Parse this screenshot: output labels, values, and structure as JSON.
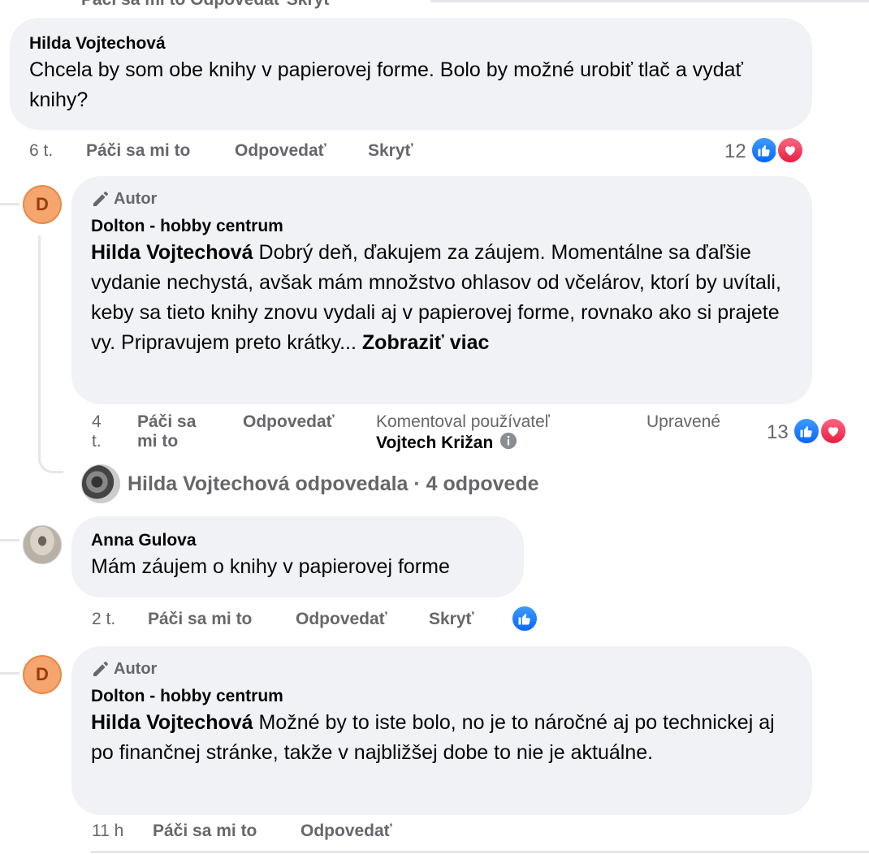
{
  "top_fragment": "Páči sa mi to   Odpovedať   Skryť",
  "comment1": {
    "author": "Hilda Vojtechová",
    "text": "Chcela by som obe knihy v papierovej forme. Bolo by možné urobiť tlač a vydať knihy?",
    "time": "6 t.",
    "like_label": "Páči sa mi to",
    "reply_label": "Odpovedať",
    "hide_label": "Skryť",
    "reaction_count": "12"
  },
  "reply1": {
    "badge": "Autor",
    "author": "Dolton - hobby centrum",
    "mention": "Hilda Vojtechová",
    "text": "Dobrý deň, ďakujem za záujem. Momentálne sa ďaľšie vydanie nechystá, avšak mám množstvo ohlasov od včelárov, ktorí by uvítali, keby sa tieto knihy znovu vydali aj v papierovej forme, rovnako ako si prajete vy. Pripravujem preto krátky...",
    "see_more": "Zobraziť viac",
    "time_line1": "4",
    "time_line2": "t.",
    "like_line1": "Páči sa",
    "like_line2": "mi to",
    "reply_label": "Odpovedať",
    "commented_by_label": "Komentoval používateľ",
    "commented_by_name": "Vojtech Križan",
    "edited_label": "Upravené",
    "reaction_count": "13",
    "avatar_letter": "D"
  },
  "more_replies": "Hilda Vojtechová odpovedala · 4 odpovede",
  "comment2": {
    "author": "Anna Gulova",
    "text": "Mám záujem o knihy v papierovej forme",
    "time": "2 t.",
    "like_label": "Páči sa mi to",
    "reply_label": "Odpovedať",
    "hide_label": "Skryť"
  },
  "reply2": {
    "badge": "Autor",
    "author": "Dolton - hobby centrum",
    "mention": "Hilda Vojtechová",
    "text": "Možné by to iste bolo, no je to náročné aj po technickej aj po finančnej stránke, takže v najbližšej dobe to nie je aktuálne.",
    "time": "11 h",
    "like_label": "Páči sa mi to",
    "reply_label": "Odpovedať",
    "avatar_letter": "D"
  },
  "colors": {
    "like": "#0866ff",
    "love": "#e61e44",
    "bubble": "#f0f2f5",
    "meta": "#65676b",
    "avatar": "#f5a66e"
  }
}
